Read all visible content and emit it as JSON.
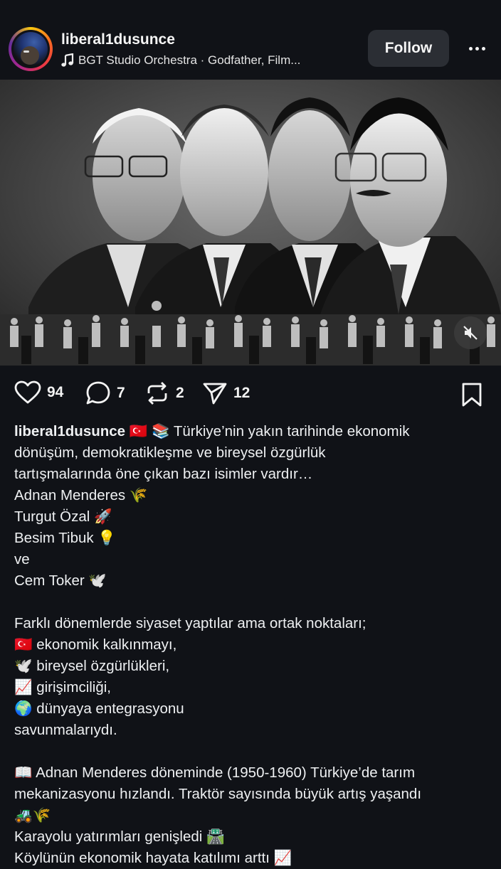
{
  "header": {
    "username": "liberal1dusunce",
    "music_label": "BGT Studio Orchestra · Godfather, Film...",
    "follow_label": "Follow"
  },
  "actions": {
    "likes": "94",
    "comments": "7",
    "reposts": "2",
    "shares": "12"
  },
  "caption": {
    "author": "liberal1dusunce",
    "lines": [
      "🇹🇷 📚 Türkiye’nin yakın tarihinde ekonomik",
      "dönüşüm, demokratikleşme ve bireysel özgürlük",
      "tartışmalarında öne çıkan bazı isimler vardır…",
      "Adnan Menderes 🌾",
      "Turgut Özal 🚀",
      "Besim Tibuk 💡",
      "ve",
      "Cem Toker 🕊️",
      "",
      "Farklı dönemlerde siyaset yaptılar ama ortak noktaları;",
      "🇹🇷  ekonomik kalkınmayı,",
      "🕊️  bireysel özgürlükleri,",
      "📈  girişimciliği,",
      "🌍  dünyaya entegrasyonu",
      "savunmalarıydı.",
      "",
      "📖  Adnan Menderes döneminde (1950-1960) Türkiye’de tarım",
      "mekanizasyonu hızlandı. Traktör sayısında büyük artış yaşandı",
      "🚜🌾",
      "Karayolu yatırımları genişledi 🛣️",
      "Köylünün ekonomik hayata katılımı arttı 📈"
    ]
  },
  "colors": {
    "background": "#101217",
    "button_bg": "#2b2e34",
    "text": "#f2f3f5"
  },
  "icons": [
    "music-note-icon",
    "more-icon",
    "mute-icon",
    "heart-icon",
    "comment-icon",
    "repost-icon",
    "share-icon",
    "bookmark-icon"
  ]
}
